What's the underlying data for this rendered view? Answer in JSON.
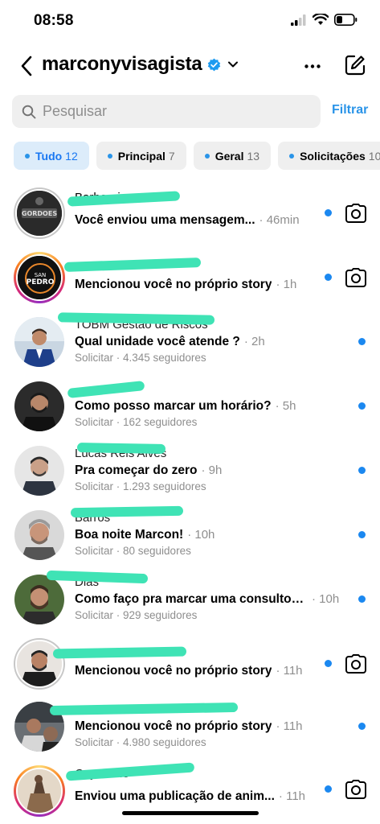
{
  "status": {
    "time": "08:58"
  },
  "header": {
    "username": "marconyvisagista"
  },
  "search": {
    "placeholder": "Pesquisar",
    "value": "",
    "filter_label": "Filtrar"
  },
  "chips": [
    {
      "label": "Tudo",
      "count": "12"
    },
    {
      "label": "Principal",
      "count": "7"
    },
    {
      "label": "Geral",
      "count": "13"
    },
    {
      "label": "Solicitações",
      "count": "10"
    }
  ],
  "conversations": [
    {
      "name": "Barbearia",
      "message": "Você enviou uma mensagem...",
      "time": "· 46min",
      "sub": "",
      "unread": true,
      "camera": true,
      "avatar": "dark-logo"
    },
    {
      "name": "",
      "message": "Mencionou você no próprio story",
      "time": "· 1h",
      "sub": "",
      "unread": true,
      "camera": true,
      "avatar": "orange-logo"
    },
    {
      "name": "TOBM Gestão de Riscos",
      "message": "Qual unidade você atende ?",
      "time": "· 2h",
      "sub": "Solicitar · 4.345 seguidores",
      "unread": true,
      "camera": false,
      "avatar": "blue-suit"
    },
    {
      "name": "",
      "message": "Como posso marcar um horário?",
      "time": "· 5h",
      "sub": "Solicitar · 162 seguidores",
      "unread": true,
      "camera": false,
      "avatar": "dark-man"
    },
    {
      "name": "Lucas Reis Alves",
      "message": "Pra começar do zero",
      "time": "· 9h",
      "sub": "Solicitar · 1.293 seguidores",
      "unread": true,
      "camera": false,
      "avatar": "grey-man"
    },
    {
      "name": "Barros",
      "message": "Boa noite Marcon!",
      "time": "· 10h",
      "sub": "Solicitar · 80 seguidores",
      "unread": true,
      "camera": false,
      "avatar": "beard-man"
    },
    {
      "name": "Dias",
      "message": "Como faço pra marcar uma consultori...",
      "time": "· 10h",
      "sub": "Solicitar · 929 seguidores",
      "unread": true,
      "camera": false,
      "avatar": "green-man"
    },
    {
      "name": "",
      "message": "Mencionou você no próprio story",
      "time": "· 11h",
      "sub": "",
      "unread": true,
      "camera": true,
      "avatar": "tattoo-man"
    },
    {
      "name": "",
      "message": "Mencionou você no próprio story",
      "time": "· 11h",
      "sub": "Solicitar · 4.980 seguidores",
      "unread": true,
      "camera": false,
      "avatar": "barber"
    },
    {
      "name": "Ceyzeane",
      "message": "Enviou uma publicação de anim...",
      "time": "· 11h",
      "sub": "",
      "unread": true,
      "camera": true,
      "avatar": "horse"
    }
  ],
  "colors": {
    "accent": "#1b88f0",
    "filter": "#2a94e8",
    "redact": "#3fe3b5"
  },
  "icons": [
    "back-icon",
    "verified-icon",
    "chevron-down-icon",
    "more-icon",
    "compose-icon",
    "search-icon",
    "camera-icon"
  ]
}
